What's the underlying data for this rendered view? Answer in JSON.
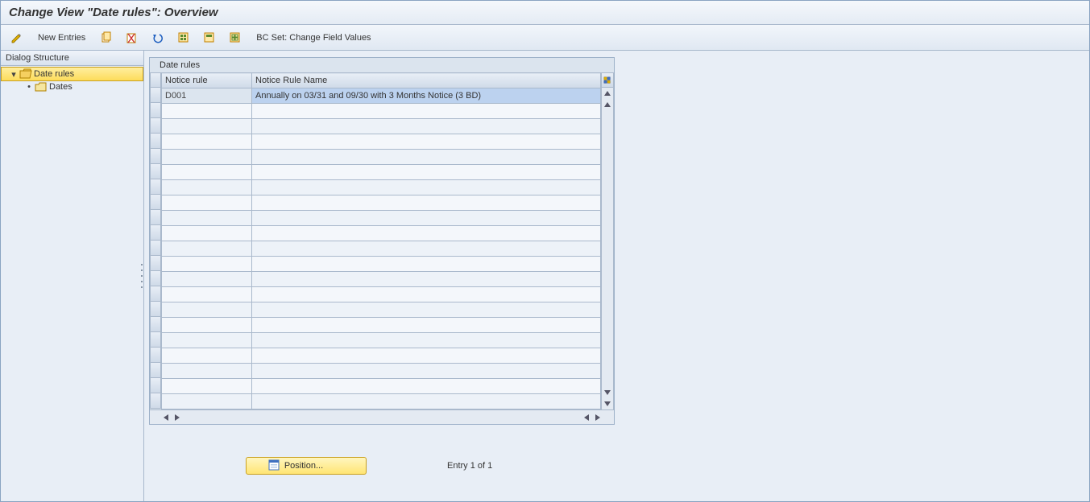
{
  "title": "Change View \"Date rules\": Overview",
  "toolbar": {
    "new_entries_label": "New Entries",
    "bc_set_label": "BC Set: Change Field Values"
  },
  "sidebar": {
    "header": "Dialog Structure",
    "items": [
      {
        "label": "Date rules",
        "selected": true,
        "open": true
      },
      {
        "label": "Dates",
        "selected": false,
        "open": false
      }
    ]
  },
  "grid": {
    "title": "Date rules",
    "columns": [
      {
        "label": "Notice rule"
      },
      {
        "label": "Notice Rule Name"
      }
    ],
    "rows": [
      {
        "notice_rule": "D001",
        "notice_rule_name": "Annually on 03/31 and 09/30 with 3 Months Notice (3 BD)"
      }
    ],
    "empty_row_count": 20
  },
  "footer": {
    "position_label": "Position...",
    "entry_text": "Entry 1 of 1"
  },
  "icons": {
    "folder_open": "folder-open-icon",
    "folder_closed": "folder-icon",
    "config": "table-settings-icon"
  },
  "colors": {
    "selection_bg": "#bcd2ef",
    "highlight_bg": "#fddc5a"
  }
}
